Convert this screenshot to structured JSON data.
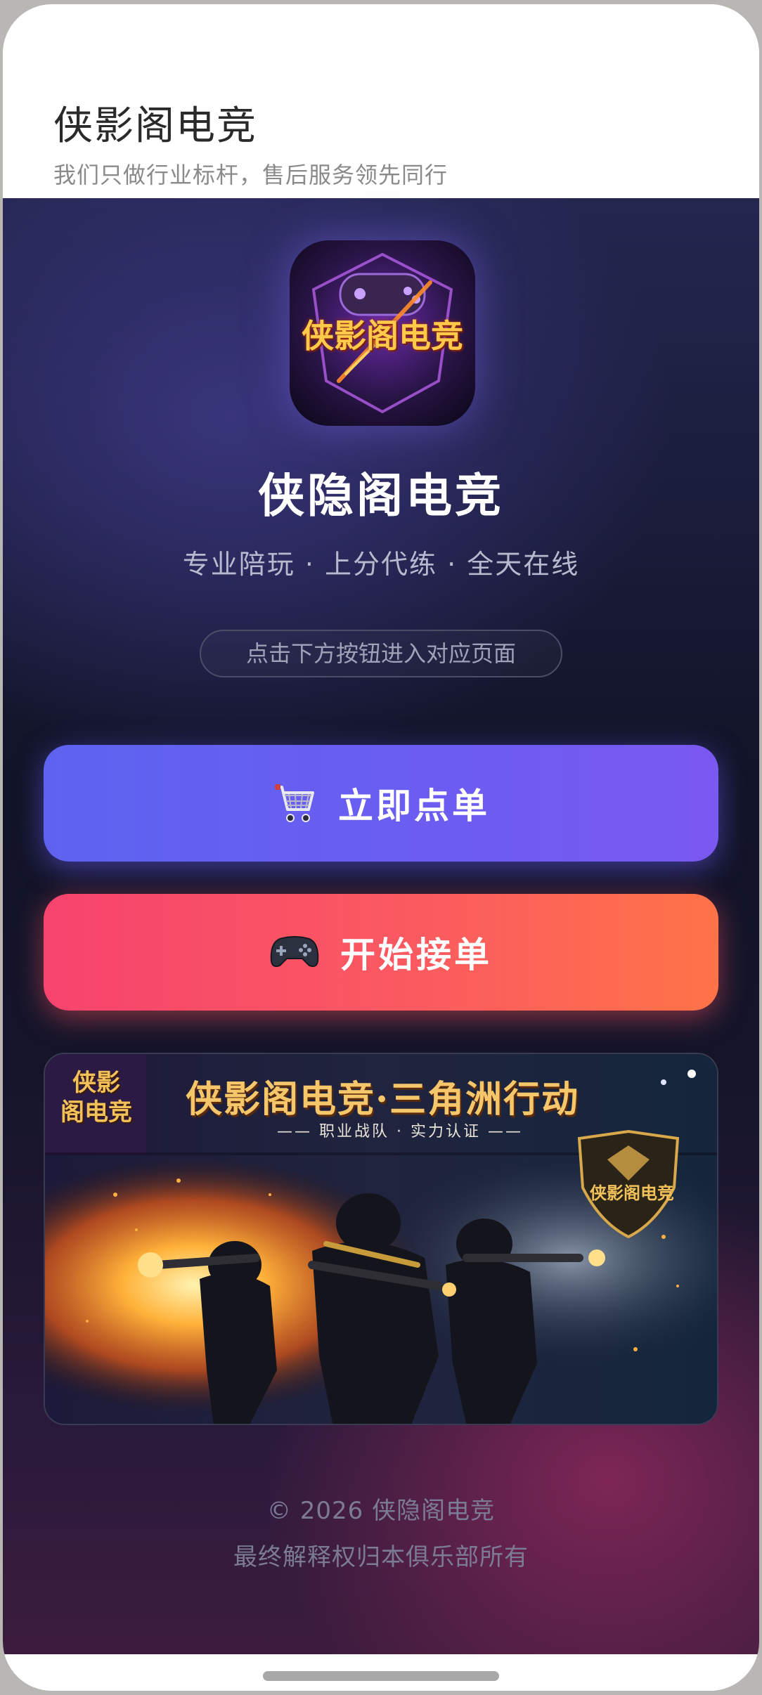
{
  "header": {
    "title": "侠影阁电竞",
    "subtitle": "我们只做行业标杆，售后服务领先同行"
  },
  "hero": {
    "logo_icon": "gamepad-shield-logo",
    "logo_text": "侠影阁电竞",
    "brand_name": "侠隐阁电竞",
    "tagline": "专业陪玩 · 上分代练 · 全天在线",
    "hint": "点击下方按钮进入对应页面"
  },
  "buttons": {
    "order": {
      "label": "立即点单",
      "icon": "shopping-cart-icon"
    },
    "accept": {
      "label": "开始接单",
      "icon": "gamepad-icon"
    }
  },
  "banner": {
    "title": "侠影阁电竞·三角洲行动",
    "subtitle": "—— 职业战队 · 实力认证 ——",
    "logo_text_line1": "侠影",
    "logo_text_line2": "阁电竞",
    "badge_text": "侠影阁电竞"
  },
  "footer": {
    "copyright": "© 2026 侠隐阁电竞",
    "rights": "最终解释权归本俱乐部所有"
  },
  "colors": {
    "order_button": "#6a5ef2",
    "accept_button": "#fb5a60",
    "gold_text": "#f5c76a"
  }
}
